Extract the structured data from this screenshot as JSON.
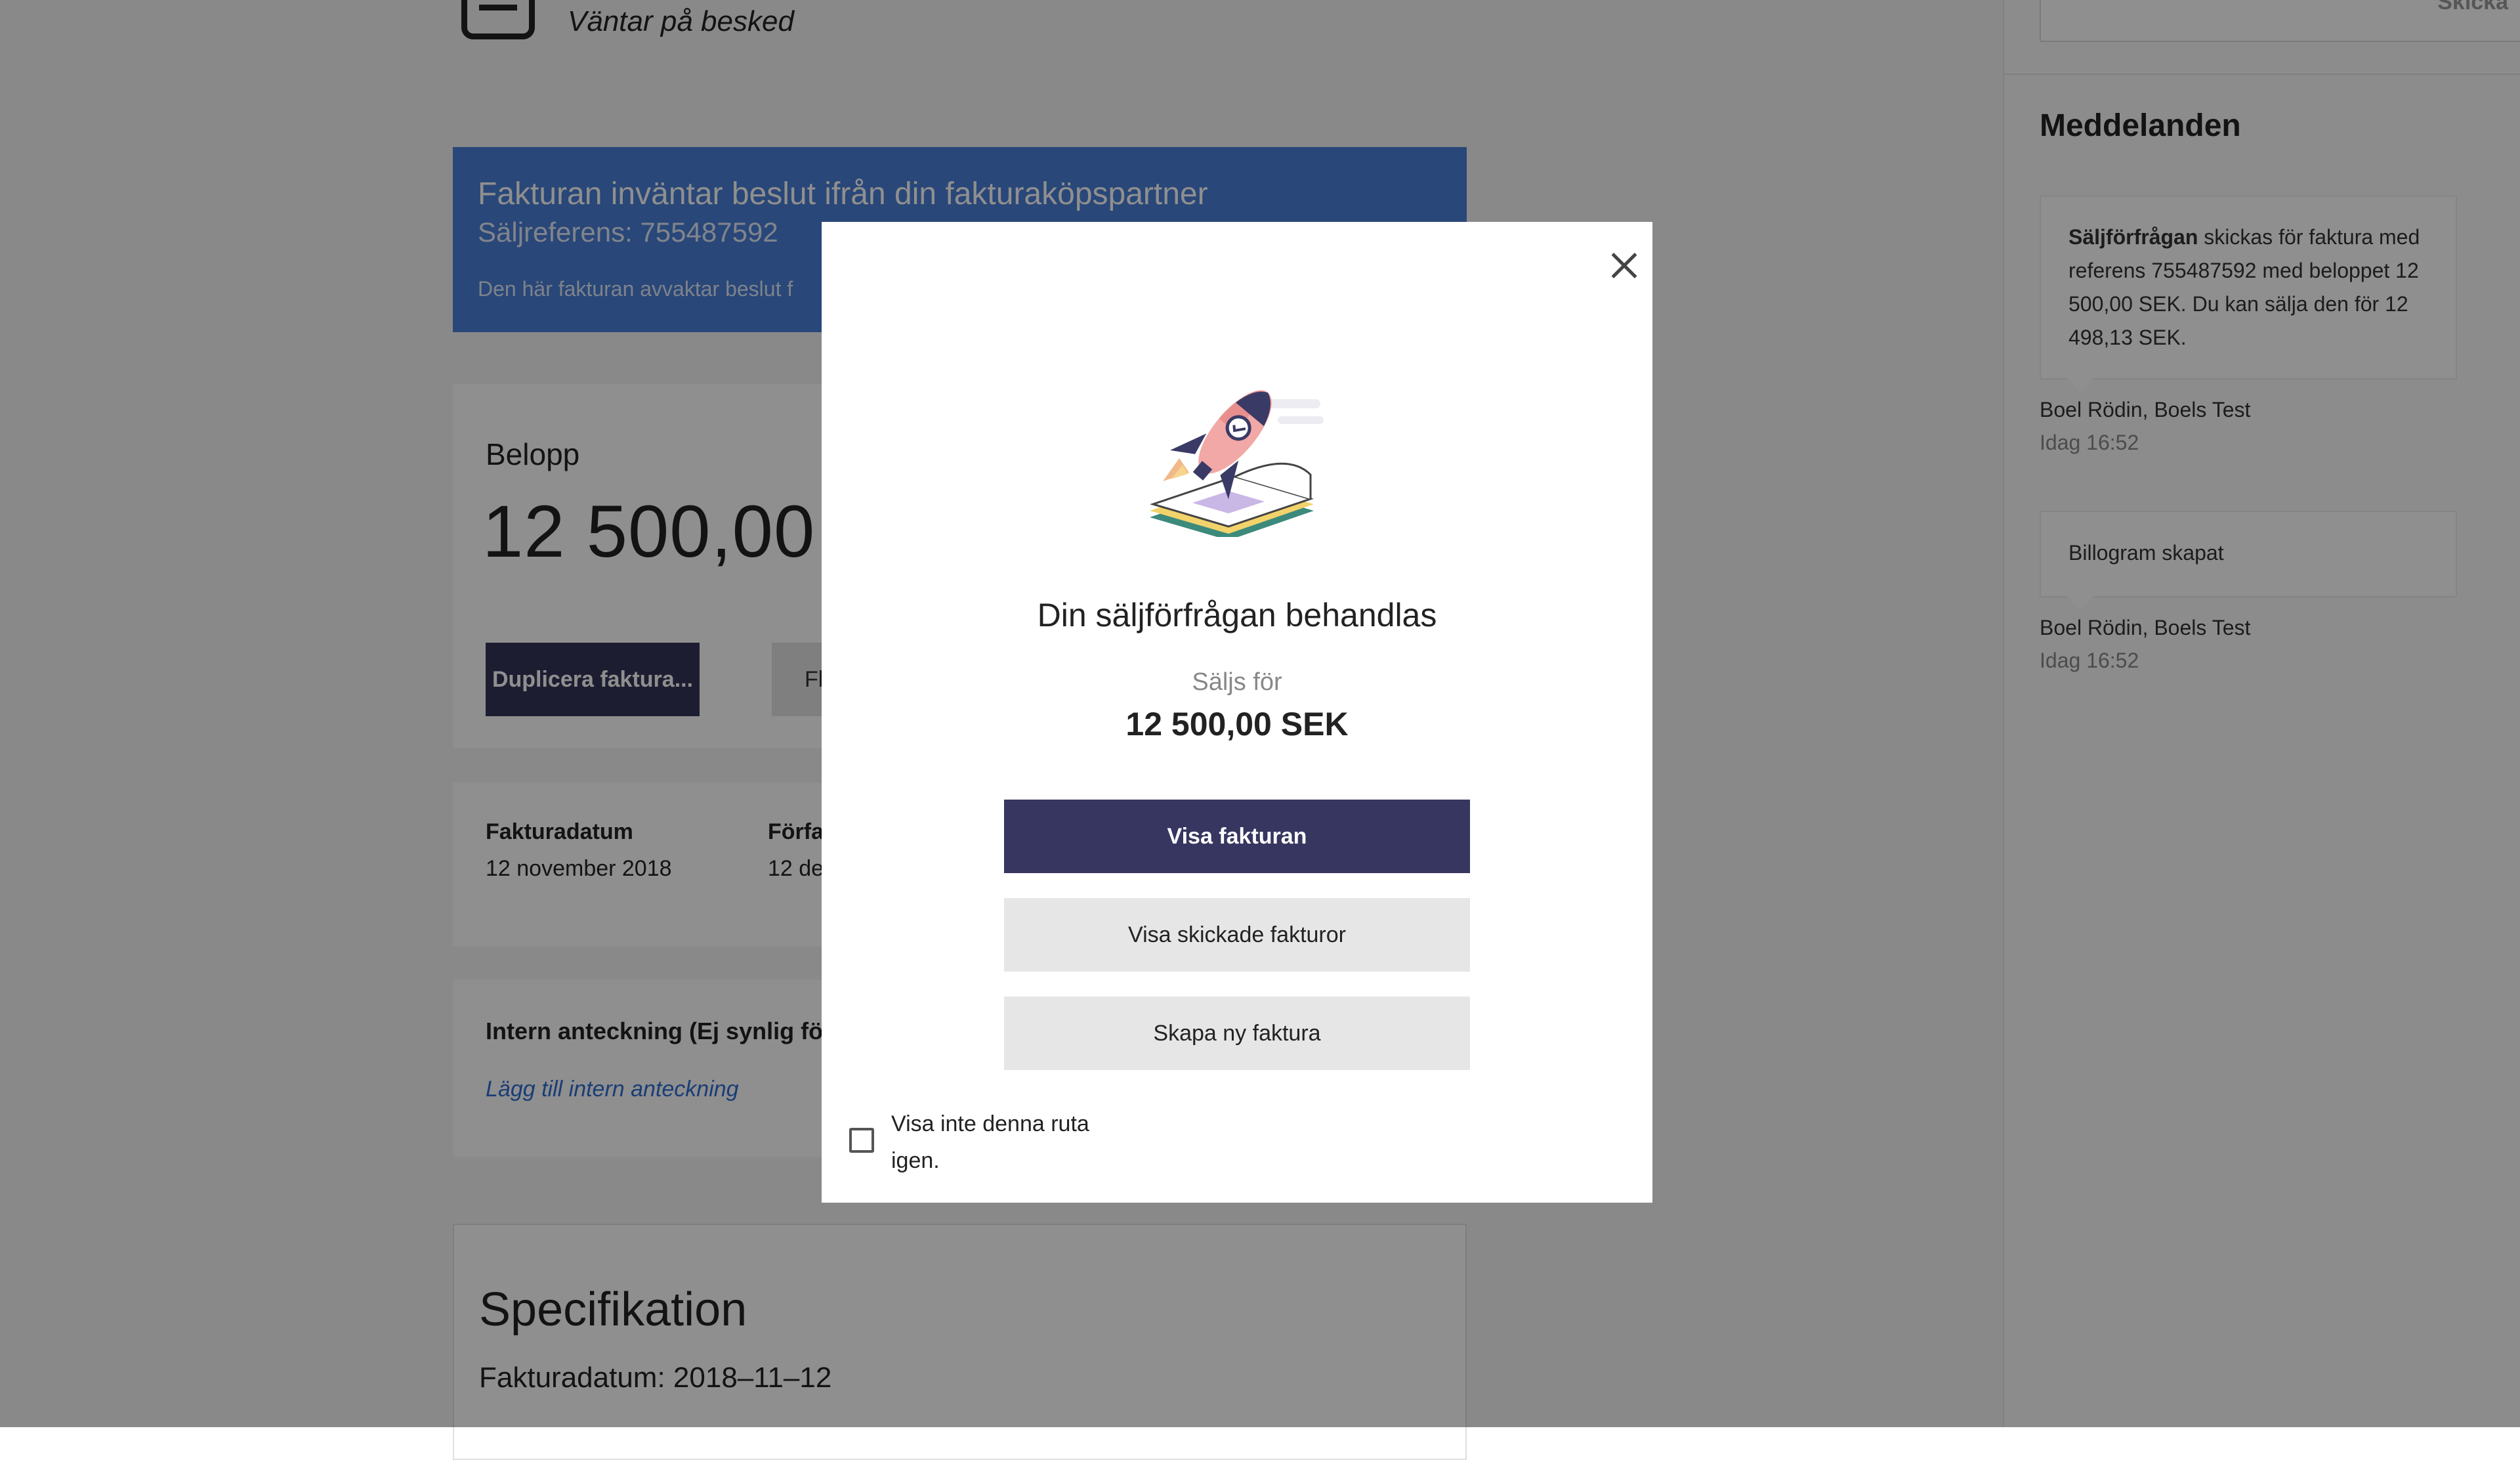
{
  "page": {
    "status_text": "Väntar på besked",
    "banner": {
      "title": "Fakturan inväntar beslut ifrån din fakturaköpspartner",
      "reference": "Säljreferens: 755487592",
      "note": "Den här fakturan avvaktar beslut f"
    },
    "amount": {
      "label": "Belopp",
      "value": "12 500,00",
      "duplicate_button": "Duplicera faktura...",
      "second_button": "Fl"
    },
    "dates": {
      "invoice_date_label": "Fakturadatum",
      "invoice_date_value": "12 november 2018",
      "due_date_label": "Förfa",
      "due_date_value": "12 de"
    },
    "internal_note": {
      "heading": "Intern anteckning (Ej synlig för",
      "link": "Lägg till intern anteckning"
    },
    "specification": {
      "title": "Specifikation",
      "invoice_date": "Fakturadatum: 2018–11–12"
    }
  },
  "right_panel": {
    "send_label": "Skicka",
    "messages_title": "Meddelanden",
    "messages": [
      {
        "bold": "Säljförfrågan",
        "text": " skickas för faktura med referens 755487592 med beloppet 12 500,00 SEK. Du kan sälja den för 12 498,13 SEK.",
        "author": "Boel Rödin, Boels Test",
        "time": "Idag 16:52"
      },
      {
        "text": "Billogram skapat",
        "author": "Boel Rödin, Boels Test",
        "time": "Idag 16:52"
      }
    ]
  },
  "modal": {
    "title": "Din säljförfrågan behandlas",
    "sold_for_label": "Säljs för",
    "sold_for_amount": "12 500,00 SEK",
    "primary_button": "Visa fakturan",
    "secondary_button_1": "Visa skickade fakturor",
    "secondary_button_2": "Skapa ny faktura",
    "checkbox_label": "Visa inte denna ruta igen.",
    "checkbox_checked": false
  },
  "colors": {
    "banner": "#4a7fd6",
    "primary": "#363660",
    "link": "#2d6ed3",
    "overlay": "rgba(0,0,0,0.44)"
  }
}
